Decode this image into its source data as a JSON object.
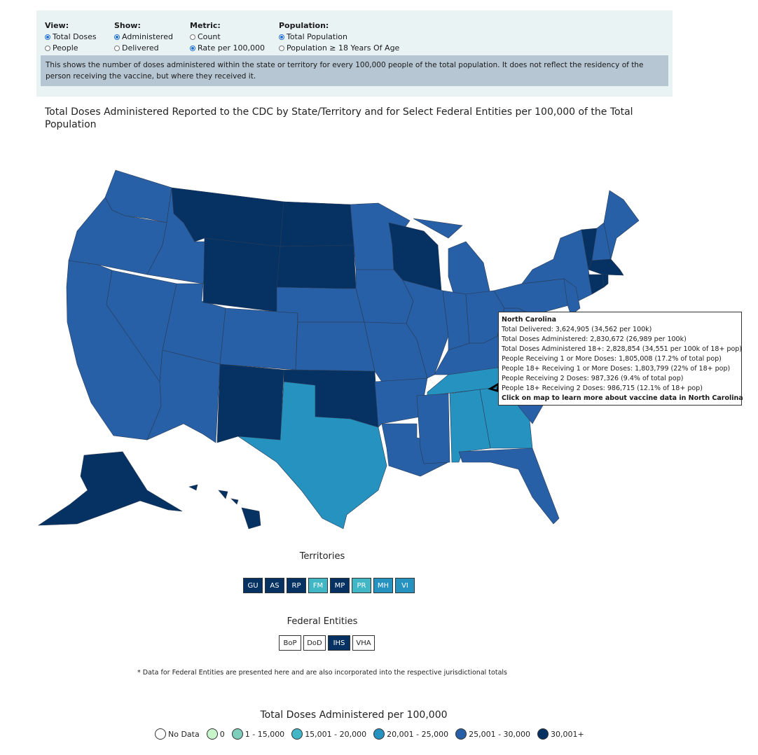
{
  "controls": {
    "groups": [
      {
        "header": "View:",
        "options": [
          {
            "label": "Total Doses",
            "selected": true
          },
          {
            "label": "People",
            "selected": false
          }
        ]
      },
      {
        "header": "Show:",
        "options": [
          {
            "label": "Administered",
            "selected": true
          },
          {
            "label": "Delivered",
            "selected": false
          }
        ]
      },
      {
        "header": "Metric:",
        "options": [
          {
            "label": "Count",
            "selected": false
          },
          {
            "label": "Rate per 100,000",
            "selected": true
          }
        ]
      },
      {
        "header": "Population:",
        "options": [
          {
            "label": "Total Population",
            "selected": true
          },
          {
            "label": "Population ≥ 18 Years Of Age",
            "selected": false
          }
        ]
      }
    ],
    "description": "This shows the number of doses administered within the state or territory for every 100,000 people of the total population. It does not reflect the residency of the person receiving the vaccine, but where they received it."
  },
  "map_title": "Total Doses Administered Reported to the CDC by State/Territory and for Select Federal Entities per 100,000 of the Total Population",
  "colors": {
    "no_data": "#ffffff",
    "zero": "#c7f5c9",
    "c1": "#7fcdbb",
    "c2": "#41b6c4",
    "c3": "#2592c0",
    "c4": "#2760a6",
    "c5": "#063263"
  },
  "states": [
    {
      "abbr": "WA",
      "category": "c4"
    },
    {
      "abbr": "OR",
      "category": "c4"
    },
    {
      "abbr": "CA",
      "category": "c4"
    },
    {
      "abbr": "ID",
      "category": "c4"
    },
    {
      "abbr": "NV",
      "category": "c4"
    },
    {
      "abbr": "UT",
      "category": "c4"
    },
    {
      "abbr": "AZ",
      "category": "c4"
    },
    {
      "abbr": "MT",
      "category": "c5"
    },
    {
      "abbr": "WY",
      "category": "c5"
    },
    {
      "abbr": "CO",
      "category": "c4"
    },
    {
      "abbr": "NM",
      "category": "c5"
    },
    {
      "abbr": "ND",
      "category": "c5"
    },
    {
      "abbr": "SD",
      "category": "c5"
    },
    {
      "abbr": "NE",
      "category": "c4"
    },
    {
      "abbr": "KS",
      "category": "c4"
    },
    {
      "abbr": "OK",
      "category": "c5"
    },
    {
      "abbr": "TX",
      "category": "c3"
    },
    {
      "abbr": "MN",
      "category": "c4"
    },
    {
      "abbr": "IA",
      "category": "c4"
    },
    {
      "abbr": "MO",
      "category": "c4"
    },
    {
      "abbr": "AR",
      "category": "c4"
    },
    {
      "abbr": "LA",
      "category": "c4"
    },
    {
      "abbr": "WI",
      "category": "c5"
    },
    {
      "abbr": "IL",
      "category": "c4"
    },
    {
      "abbr": "MI",
      "category": "c4"
    },
    {
      "abbr": "IN",
      "category": "c4"
    },
    {
      "abbr": "OH",
      "category": "c4"
    },
    {
      "abbr": "KY",
      "category": "c4"
    },
    {
      "abbr": "TN",
      "category": "c3"
    },
    {
      "abbr": "MS",
      "category": "c4"
    },
    {
      "abbr": "AL",
      "category": "c3"
    },
    {
      "abbr": "GA",
      "category": "c3"
    },
    {
      "abbr": "FL",
      "category": "c4"
    },
    {
      "abbr": "SC",
      "category": "c4"
    },
    {
      "abbr": "NC",
      "category": "c4"
    },
    {
      "abbr": "VA",
      "category": "c4"
    },
    {
      "abbr": "WV",
      "category": "c4"
    },
    {
      "abbr": "PA",
      "category": "c4"
    },
    {
      "abbr": "NY",
      "category": "c4"
    },
    {
      "abbr": "VT",
      "category": "c5"
    },
    {
      "abbr": "NH",
      "category": "c4"
    },
    {
      "abbr": "ME",
      "category": "c4"
    },
    {
      "abbr": "MA",
      "category": "c5"
    },
    {
      "abbr": "CT",
      "category": "c5"
    },
    {
      "abbr": "RI",
      "category": "c5"
    },
    {
      "abbr": "NJ",
      "category": "c4"
    },
    {
      "abbr": "AK",
      "category": "c5"
    },
    {
      "abbr": "HI",
      "category": "c5"
    }
  ],
  "tooltip": {
    "state": "North Carolina",
    "lines": [
      "Total Delivered: 3,624,905 (34,562 per 100k)",
      "Total Doses Administered: 2,830,672 (26,989 per 100k)",
      "Total Doses Administered 18+: 2,828,854 (34,551 per 100k of 18+ pop)",
      "People Receiving 1 or More Doses: 1,805,008 (17.2% of total pop)",
      "People 18+ Receiving 1 or More Doses: 1,803,799 (22% of 18+ pop)",
      "People Receiving 2 Doses: 987,326 (9.4% of total pop)",
      "People 18+ Receiving 2 Doses: 986,715 (12.1% of 18+ pop)"
    ],
    "cta": "Click on map to learn more about vaccine data in North Carolina"
  },
  "territories": {
    "label": "Territories",
    "items": [
      {
        "abbr": "GU",
        "category": "c5"
      },
      {
        "abbr": "AS",
        "category": "c5"
      },
      {
        "abbr": "RP",
        "category": "c5"
      },
      {
        "abbr": "FM",
        "category": "c2"
      },
      {
        "abbr": "MP",
        "category": "c5"
      },
      {
        "abbr": "PR",
        "category": "c2"
      },
      {
        "abbr": "MH",
        "category": "c3"
      },
      {
        "abbr": "VI",
        "category": "c3"
      }
    ]
  },
  "federal_entities": {
    "label": "Federal Entities",
    "items": [
      {
        "abbr": "BoP",
        "category": "no_data"
      },
      {
        "abbr": "DoD",
        "category": "no_data"
      },
      {
        "abbr": "IHS",
        "category": "c5"
      },
      {
        "abbr": "VHA",
        "category": "no_data"
      }
    ],
    "footnote": "* Data for Federal Entities are presented here and are also incorporated into the respective jurisdictional totals"
  },
  "legend": {
    "title": "Total Doses Administered per 100,000",
    "items": [
      {
        "label": "No Data",
        "category": "no_data"
      },
      {
        "label": "0",
        "category": "zero"
      },
      {
        "label": "1 - 15,000",
        "category": "c1"
      },
      {
        "label": "15,001 - 20,000",
        "category": "c2"
      },
      {
        "label": "20,001 - 25,000",
        "category": "c3"
      },
      {
        "label": "25,001 - 30,000",
        "category": "c4"
      },
      {
        "label": "30,001+",
        "category": "c5"
      }
    ]
  }
}
